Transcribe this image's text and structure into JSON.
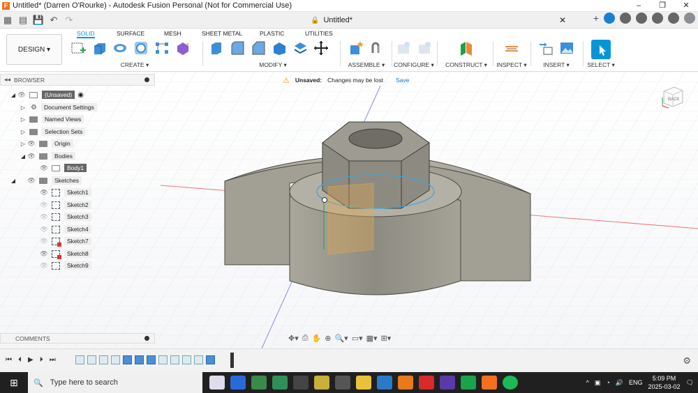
{
  "window": {
    "title": "Untitled* (Darren O'Rourke) - Autodesk Fusion Personal (Not for Commercial Use)",
    "minimize": "–",
    "restore": "❐",
    "close": "✕"
  },
  "document_tab": {
    "label": "Untitled*"
  },
  "workspace_button": "DESIGN ▾",
  "ribbon_tabs": [
    "SOLID",
    "SURFACE",
    "MESH",
    "SHEET METAL",
    "PLASTIC",
    "UTILITIES"
  ],
  "active_tab_color": "#0696d7",
  "groups": {
    "create": "CREATE ▾",
    "modify": "MODIFY ▾",
    "assemble": "ASSEMBLE ▾",
    "configure": "CONFIGURE ▾",
    "construct": "CONSTRUCT ▾",
    "inspect": "INSPECT ▾",
    "insert": "INSERT ▾",
    "select": "SELECT ▾"
  },
  "browser": {
    "header": "BROWSER",
    "root": "(Unsaved)",
    "items": {
      "document_settings": "Document Settings",
      "named_views": "Named Views",
      "selection_sets": "Selection Sets",
      "origin": "Origin",
      "bodies": "Bodies",
      "body1": "Body1",
      "sketches": "Sketches"
    },
    "sketches": [
      "Sketch1",
      "Sketch2",
      "Sketch3",
      "Sketch4",
      "Sketch7",
      "Sketch8",
      "Sketch9"
    ]
  },
  "unsaved_banner": {
    "title": "Unsaved:",
    "message": "Changes may be lost",
    "action": "Save"
  },
  "comments": {
    "header": "COMMENTS"
  },
  "viewcube_label": "BACK",
  "taskbar": {
    "search_placeholder": "Type here to search",
    "language": "ENG",
    "time": "5:09 PM",
    "date": "2025-03-02"
  }
}
